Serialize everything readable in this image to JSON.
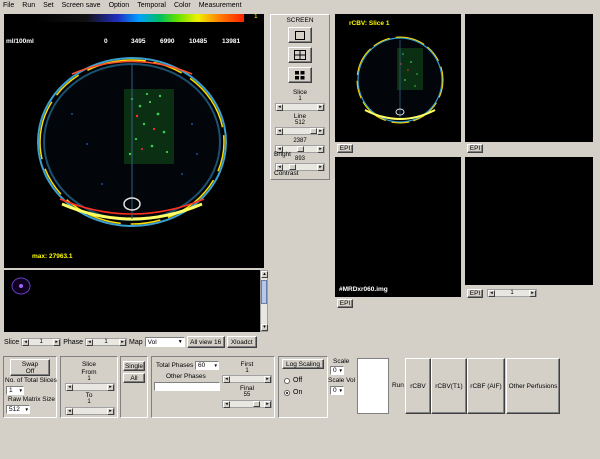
{
  "menu": [
    "File",
    "Run",
    "Set",
    "Screen save",
    "Option",
    "Temporal",
    "Color",
    "Measurement"
  ],
  "main_view": {
    "unit": "ml/100ml",
    "colorbar_ticks": [
      "0",
      "3495",
      "6990",
      "10485",
      "13981"
    ],
    "colorbar_top": "1",
    "max_label": "max: 27963.1"
  },
  "main_controls": {
    "slice_label": "Slice",
    "slice_value": "1",
    "phase_label": "Phase",
    "phase_value": "1",
    "map_label": "Map",
    "map_value": "Vol",
    "all_view_label": "All view 16",
    "xloadct_label": "Xloadct"
  },
  "screen_panel": {
    "title": "SCREEN",
    "slice_label": "Slice",
    "slice_value": "1",
    "line_label": "Line",
    "line_value": "512",
    "bright_value": "2387",
    "bright_label": "Bright",
    "contrast_value": "893",
    "contrast_label": "Contrast"
  },
  "viewports": {
    "tl_title": "rCBV: Slice  1",
    "bl_filename": "#MRDxr060.img",
    "epi": "EPI",
    "br_value": "1"
  },
  "bottom": {
    "swap_label": "Swap",
    "swap_value": "Off",
    "total_slices_label": "No. of Total Slices",
    "total_slices_value": "1",
    "raw_matrix_label": "Raw Matrix Size",
    "raw_matrix_value": "512",
    "slice_from_label": "Slice",
    "from_label": "From",
    "from_value": "1",
    "to_label": "To",
    "to_value": "1",
    "single_label": "Single",
    "all_label": "All",
    "total_phases_label": "Total Phases",
    "total_phases_value": "60",
    "other_phases_label": "Other  Phases",
    "first_label": "First",
    "first_value": "1",
    "final_label": "Final",
    "final_value": "55",
    "log_scaling_label": "Log Scaling",
    "off_label": "Off",
    "on_label": "On",
    "scale_label": "Scale",
    "scale_value": "0",
    "scale_vol_label": "Scale Vol",
    "scale_vol_value": "0",
    "run_label": "Run",
    "rcbv_label": "rCBV",
    "rcbv_t1_label": "rCBV(T1)",
    "rcbf_label": "rCBF (AIF)",
    "other_perf_label": "Other Perfusions"
  }
}
